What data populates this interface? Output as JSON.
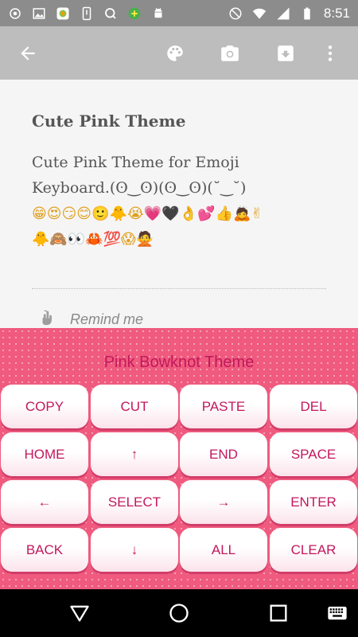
{
  "status_bar": {
    "time": "8:51",
    "left_icons": [
      "cast-icon",
      "image-icon",
      "app-icon",
      "phone-icon",
      "q-icon",
      "game-icon",
      "android-icon"
    ],
    "right_icons": [
      "dnd-icon",
      "wifi-icon",
      "signal-icon",
      "battery-icon"
    ]
  },
  "toolbar": {
    "icons": [
      "back-arrow-icon",
      "palette-icon",
      "camera-icon",
      "archive-icon",
      "more-vert-icon"
    ]
  },
  "note": {
    "title": "Cute Pink Theme",
    "body_line1": "Cute Pink Theme for Emoji",
    "body_line2": "Keyboard.(ʘ‿ʘ)(ʘ‿ʘ)(˘‿˘)",
    "emoji_line1": "😁😍😏😊🙂🐥😭💗🖤👌💕👍🙇✌",
    "emoji_line2": "🐥🙈👀🦀💯😱🙅",
    "reminder_label": "Remind me"
  },
  "keyboard": {
    "theme_name": "Pink Bowknot Theme",
    "rows": [
      [
        "COPY",
        "CUT",
        "PASTE",
        "DEL"
      ],
      [
        "HOME",
        "↑",
        "END",
        "SPACE"
      ],
      [
        "←",
        "SELECT",
        "→",
        "ENTER"
      ],
      [
        "BACK",
        "↓",
        "ALL",
        "CLEAR"
      ]
    ]
  },
  "navbar": {
    "icons": [
      "nav-back-icon",
      "nav-home-icon",
      "nav-recents-icon",
      "keyboard-icon"
    ]
  },
  "colors": {
    "status_bar": "#8c8c8c",
    "toolbar": "#bdbdbd",
    "keyboard_bg": "#ef5a7e",
    "key_text": "#c2185b"
  }
}
